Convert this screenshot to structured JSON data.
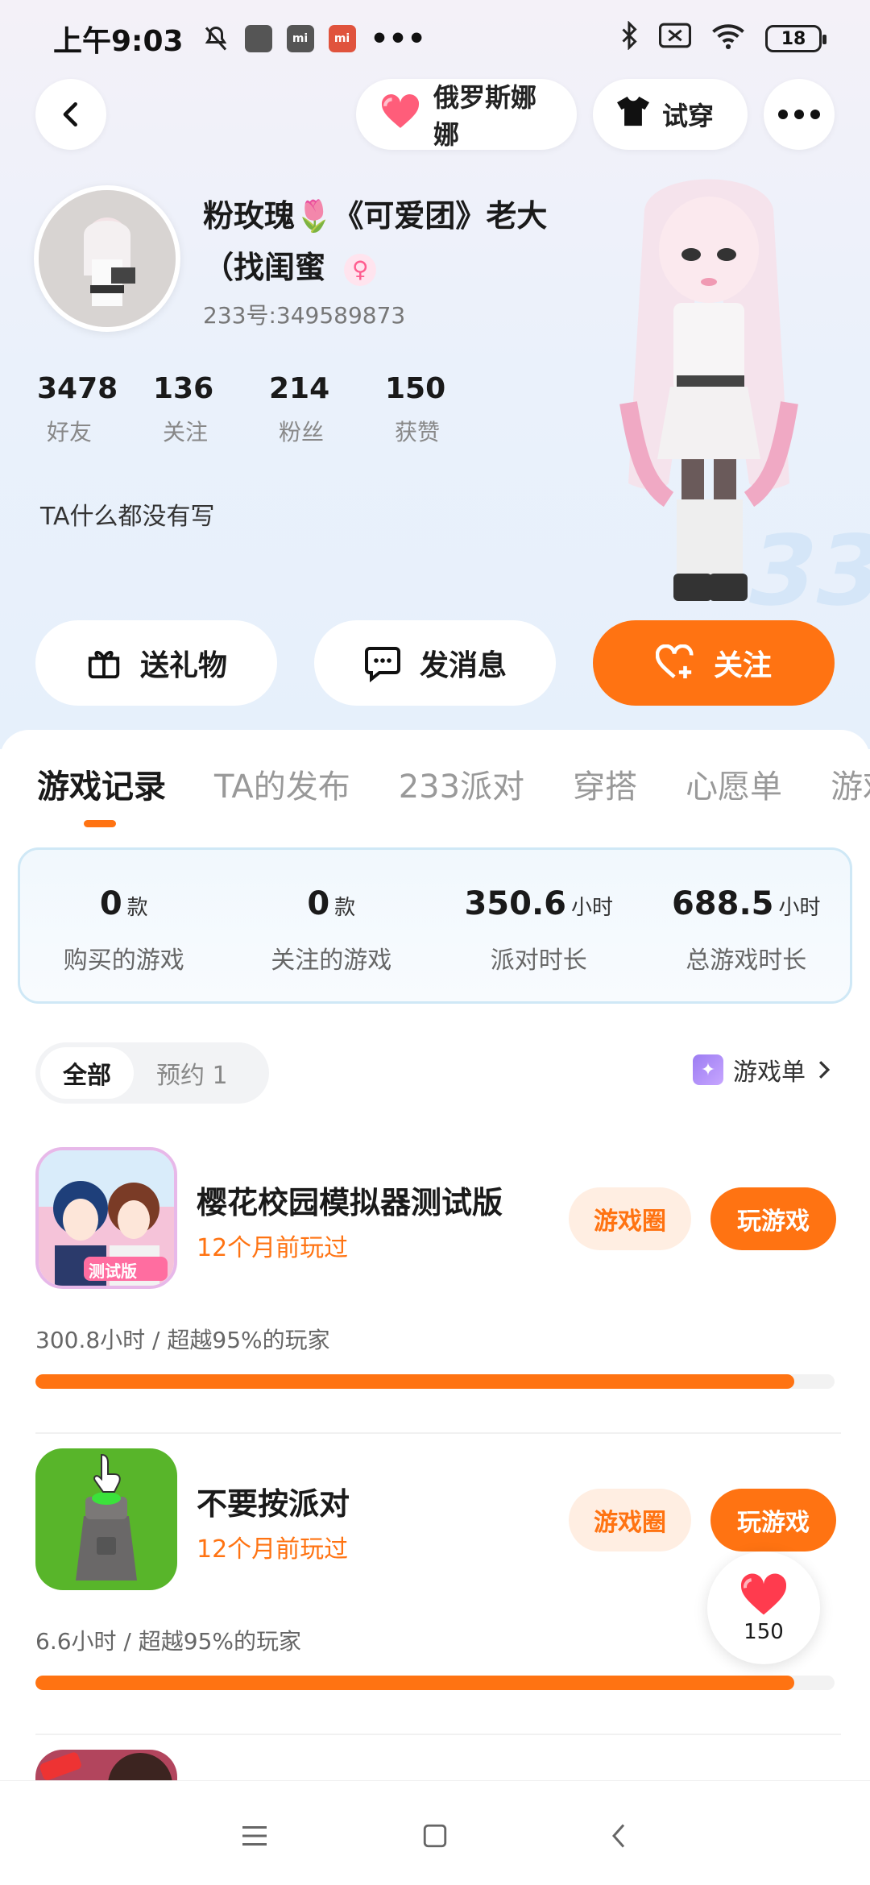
{
  "status_bar": {
    "time": "上午9:03",
    "battery": "18"
  },
  "header": {
    "friend_name": "俄罗斯娜娜",
    "try_on_label": "试穿"
  },
  "profile": {
    "nickname": "粉玫瑰🌷《可爱团》老大（找闺蜜",
    "gender_symbol": "♀",
    "uid": "233号:349589873",
    "bio": "TA什么都没有写",
    "stats": [
      {
        "value": "3478",
        "label": "好友"
      },
      {
        "value": "136",
        "label": "关注"
      },
      {
        "value": "214",
        "label": "粉丝"
      },
      {
        "value": "150",
        "label": "获赞"
      }
    ]
  },
  "actions": {
    "gift": "送礼物",
    "message": "发消息",
    "follow": "关注"
  },
  "tabs": [
    "游戏记录",
    "TA的发布",
    "233派对",
    "穿搭",
    "心愿单",
    "游戏"
  ],
  "summary": [
    {
      "value": "0",
      "unit": "款",
      "label": "购买的游戏"
    },
    {
      "value": "0",
      "unit": "款",
      "label": "关注的游戏"
    },
    {
      "value": "350.6",
      "unit": "小时",
      "label": "派对时长"
    },
    {
      "value": "688.5",
      "unit": "小时",
      "label": "总游戏时长"
    }
  ],
  "filter": {
    "all": "全部",
    "reserve": "预约 1",
    "playlist": "游戏单"
  },
  "games": [
    {
      "title": "樱花校园模拟器测试版",
      "played": "12个月前玩过",
      "stat": "300.8小时 / 超越95%的玩家",
      "progress_pct": 95,
      "circle_label": "游戏圈",
      "play_label": "玩游戏",
      "icon_badge": "测试版"
    },
    {
      "title": "不要按派对",
      "played": "12个月前玩过",
      "stat": "6.6小时 / 超越95%的玩家",
      "progress_pct": 95,
      "circle_label": "游戏圈",
      "play_label": "玩游戏"
    }
  ],
  "float_like": {
    "count": "150"
  },
  "colors": {
    "accent": "#ff7312",
    "heart": "#ff3b4e"
  }
}
